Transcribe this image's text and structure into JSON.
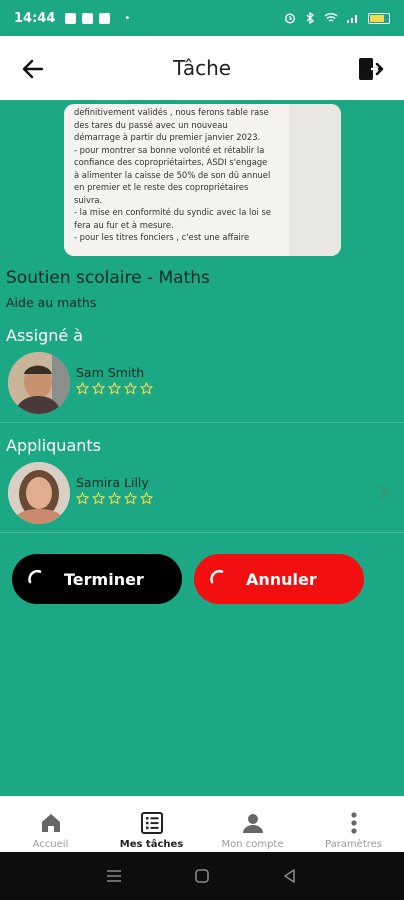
{
  "status_bar": {
    "time": "14:44",
    "dot": "•"
  },
  "app_bar": {
    "title": "Tâche"
  },
  "document_image": {
    "text": "definitivement validés , nous ferons table rase\ndes tares du passé avec un nouveau\ndémarrage à partir du premier janvier 2023.\n- pour montrer sa bonne volonté et rétablir la\nconfiance des copropriétairtes, ASDI s'engage\nà alimenter la caisse de 50% de son dû annuel\nen premier et le reste des copropriétaires\nsuivra.\n- la mise en conformité du syndic avec la loi se\nfera au fur et à mesure.\n- pour les titres fonciers , c'est une affaire"
  },
  "task": {
    "title": "Soutien scolaire - Maths",
    "subtitle": "Aide au maths"
  },
  "assigned": {
    "section_label": "Assigné à",
    "person": {
      "name": "Sam Smith",
      "rating": 0,
      "max_rating": 5
    }
  },
  "applicants": {
    "section_label": "Appliquants",
    "items": [
      {
        "name": "Samira Lilly",
        "rating": 0,
        "max_rating": 5
      }
    ]
  },
  "actions": {
    "finish_label": "Terminer",
    "cancel_label": "Annuler"
  },
  "bottom_nav": {
    "items": [
      {
        "label": "Accueil",
        "icon": "home-icon"
      },
      {
        "label": "Mes tâches",
        "icon": "tasks-icon",
        "active": true
      },
      {
        "label": "Mon compte",
        "icon": "account-icon"
      },
      {
        "label": "Paramètres",
        "icon": "more-vertical-icon"
      }
    ]
  },
  "colors": {
    "primary": "#1ca885",
    "finish": "#000000",
    "cancel": "#f10f0f",
    "star": "#f2d94e"
  }
}
